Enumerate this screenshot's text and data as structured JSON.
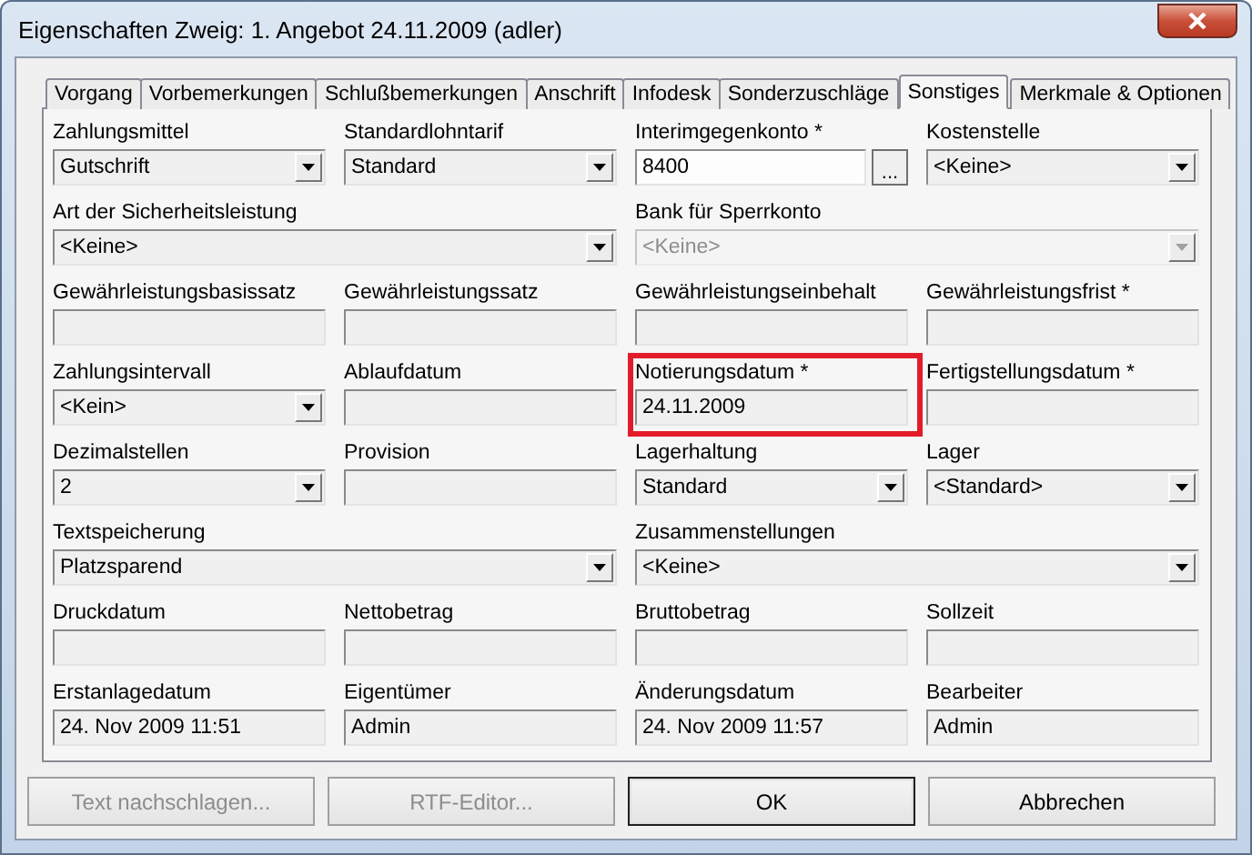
{
  "window": {
    "title": "Eigenschaften Zweig: 1. Angebot 24.11.2009 (adler)"
  },
  "tabs": [
    {
      "label": "Vorgang",
      "selected": false
    },
    {
      "label": "Vorbemerkungen",
      "selected": false
    },
    {
      "label": "Schlußbemerkungen",
      "selected": false
    },
    {
      "label": "Anschrift",
      "selected": false
    },
    {
      "label": "Infodesk",
      "selected": false
    },
    {
      "label": "Sonderzuschläge",
      "selected": false
    },
    {
      "label": "Sonstiges",
      "selected": true
    },
    {
      "label": "Merkmale & Optionen",
      "selected": false
    }
  ],
  "fields": [
    {
      "label": "Zahlungsmittel",
      "kind": "select",
      "wide": false,
      "value": "Gutschrift",
      "disabled": false,
      "highlighted": false
    },
    {
      "label": "Standardlohntarif",
      "kind": "select",
      "wide": false,
      "value": "Standard",
      "disabled": false,
      "highlighted": false
    },
    {
      "label": "Interimgegenkonto *",
      "kind": "lookup",
      "wide": false,
      "value": "8400",
      "button": "...",
      "disabled": false,
      "highlighted": false
    },
    {
      "label": "Kostenstelle",
      "kind": "select",
      "wide": false,
      "value": "<Keine>",
      "disabled": false,
      "highlighted": false
    },
    {
      "label": "Art der Sicherheitsleistung",
      "kind": "select",
      "wide": true,
      "value": "<Keine>",
      "disabled": false,
      "highlighted": false
    },
    {
      "label": "Bank für Sperrkonto",
      "kind": "select",
      "wide": true,
      "value": "<Keine>",
      "disabled": true,
      "highlighted": false
    },
    {
      "label": "Gewährleistungsbasissatz",
      "kind": "text",
      "wide": false,
      "disabled": false,
      "highlighted": false
    },
    {
      "label": "Gewährleistungssatz",
      "kind": "text",
      "wide": false,
      "disabled": false,
      "highlighted": false
    },
    {
      "label": "Gewährleistungseinbehalt",
      "kind": "text",
      "wide": false,
      "disabled": false,
      "highlighted": false
    },
    {
      "label": "Gewährleistungsfrist *",
      "kind": "text",
      "wide": false,
      "disabled": false,
      "highlighted": false
    },
    {
      "label": "Zahlungsintervall",
      "kind": "select",
      "wide": false,
      "value": "<Kein>",
      "disabled": false,
      "highlighted": false
    },
    {
      "label": "Ablaufdatum",
      "kind": "text",
      "wide": false,
      "disabled": false,
      "highlighted": false
    },
    {
      "label": "Notierungsdatum *",
      "kind": "text",
      "wide": false,
      "value": "24.11.2009",
      "disabled": false,
      "highlighted": true
    },
    {
      "label": "Fertigstellungsdatum *",
      "kind": "text",
      "wide": false,
      "disabled": false,
      "highlighted": false
    },
    {
      "label": "Dezimalstellen",
      "kind": "select",
      "wide": false,
      "value": "2",
      "disabled": false,
      "highlighted": false
    },
    {
      "label": "Provision",
      "kind": "text",
      "wide": false,
      "disabled": false,
      "highlighted": false
    },
    {
      "label": "Lagerhaltung",
      "kind": "select",
      "wide": false,
      "value": "Standard",
      "disabled": false,
      "highlighted": false
    },
    {
      "label": "Lager",
      "kind": "select",
      "wide": false,
      "value": "<Standard>",
      "disabled": false,
      "highlighted": false
    },
    {
      "label": "Textspeicherung",
      "kind": "select",
      "wide": true,
      "value": "Platzsparend",
      "disabled": false,
      "highlighted": false
    },
    {
      "label": "Zusammenstellungen",
      "kind": "select",
      "wide": true,
      "value": "<Keine>",
      "disabled": false,
      "highlighted": false
    },
    {
      "label": "Druckdatum",
      "kind": "text",
      "wide": false,
      "disabled": false,
      "highlighted": false
    },
    {
      "label": "Nettobetrag",
      "kind": "text",
      "wide": false,
      "disabled": false,
      "highlighted": false
    },
    {
      "label": "Bruttobetrag",
      "kind": "text",
      "wide": false,
      "disabled": false,
      "highlighted": false
    },
    {
      "label": "Sollzeit",
      "kind": "text",
      "wide": false,
      "disabled": false,
      "highlighted": false
    },
    {
      "label": "Erstanlagedatum",
      "kind": "text",
      "wide": false,
      "value": "24. Nov 2009 11:51",
      "disabled": false,
      "highlighted": false
    },
    {
      "label": "Eigentümer",
      "kind": "text",
      "wide": false,
      "value": "Admin",
      "disabled": false,
      "highlighted": false
    },
    {
      "label": "Änderungsdatum",
      "kind": "text",
      "wide": false,
      "value": "24. Nov 2009 11:57",
      "disabled": false,
      "highlighted": false
    },
    {
      "label": "Bearbeiter",
      "kind": "text",
      "wide": false,
      "value": "Admin",
      "disabled": false,
      "highlighted": false
    }
  ],
  "buttons": [
    {
      "label": "Text nachschlagen...",
      "disabled": true,
      "default": false
    },
    {
      "label": "RTF-Editor...",
      "disabled": true,
      "default": false
    },
    {
      "label": "OK",
      "disabled": false,
      "default": true
    },
    {
      "label": "Abbrechen",
      "disabled": false,
      "default": false
    }
  ]
}
